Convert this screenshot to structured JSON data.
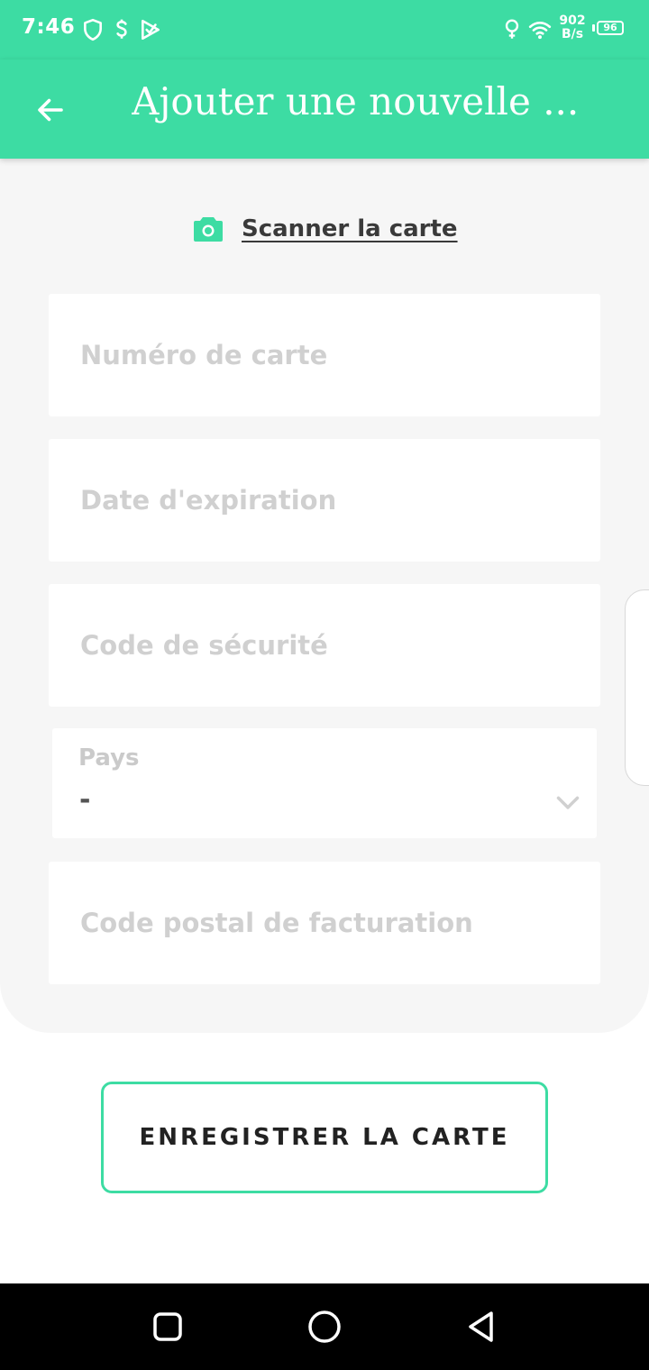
{
  "status_bar": {
    "time": "7:46",
    "net_speed_value": "902",
    "net_speed_unit": "B/s",
    "battery": "96",
    "icons": [
      "shield-icon",
      "dollar-icon",
      "check-flag-icon",
      "location-pin-icon",
      "wifi-icon"
    ]
  },
  "app_bar": {
    "title": "Ajouter une nouvelle ...",
    "back_icon": "arrow-left-icon"
  },
  "form": {
    "scan_label": "Scanner la carte",
    "scan_icon": "camera-icon",
    "card_number_placeholder": "Numéro de carte",
    "expiry_placeholder": "Date d'expiration",
    "security_code_placeholder": "Code de sécurité",
    "country_label": "Pays",
    "country_value": "-",
    "country_icon": "chevron-down-icon",
    "postal_code_placeholder": "Code postal de facturation"
  },
  "actions": {
    "save_label": "ENREGISTRER LA CARTE"
  },
  "nav_bar": {
    "icons": [
      "recents-square-icon",
      "home-circle-icon",
      "back-triangle-icon"
    ]
  },
  "colors": {
    "accent": "#3ddca3",
    "card_background": "#f6f6f6",
    "placeholder": "#d0d0d0",
    "text_dark": "#222222"
  }
}
